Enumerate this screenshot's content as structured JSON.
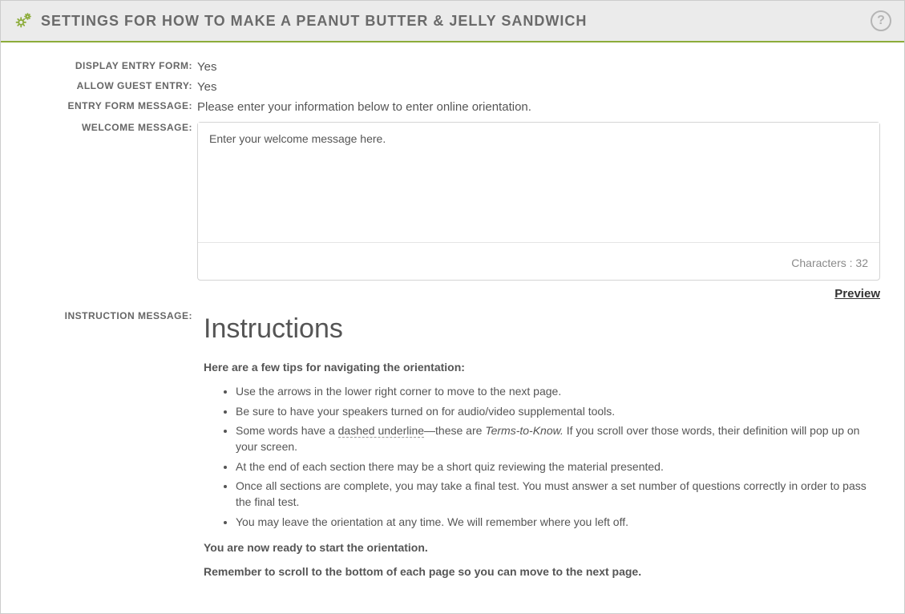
{
  "header": {
    "title": "SETTINGS FOR HOW TO MAKE A PEANUT BUTTER & JELLY SANDWICH"
  },
  "fields": {
    "display_entry_form": {
      "label": "DISPLAY ENTRY FORM:",
      "value": "Yes"
    },
    "allow_guest_entry": {
      "label": "ALLOW GUEST ENTRY:",
      "value": "Yes"
    },
    "entry_form_message": {
      "label": "ENTRY FORM MESSAGE:",
      "value": "Please enter your information below to enter online orientation."
    },
    "welcome_message": {
      "label": "WELCOME MESSAGE:",
      "value": "Enter your welcome message here.",
      "char_label": "Characters :",
      "char_count": "32"
    },
    "instruction_message": {
      "label": "INSTRUCTION MESSAGE:",
      "preview_link": "Preview",
      "heading": "Instructions",
      "intro": "Here are a few tips for navigating the orientation:",
      "tips": [
        "Use the arrows in the lower right corner to move to the next page.",
        "Be sure to have your speakers turned on for audio/video supplemental tools.",
        {
          "prefix": "Some words have a ",
          "dashed": "dashed underline",
          "mid": "—these are ",
          "italic": "Terms-to-Know.",
          "suffix": "  If you scroll over those words, their definition will pop up on your screen."
        },
        "At the end of each section there may be a short quiz reviewing the material presented.",
        "Once all sections are complete, you may take a final test. You must answer a set number of questions correctly in order to pass the final test.",
        "You may leave the orientation at any time. We will remember where you left off."
      ],
      "outro1": "You are now ready to start the orientation.",
      "outro2": "Remember to scroll to the bottom of each page so you can move to the next page."
    }
  }
}
